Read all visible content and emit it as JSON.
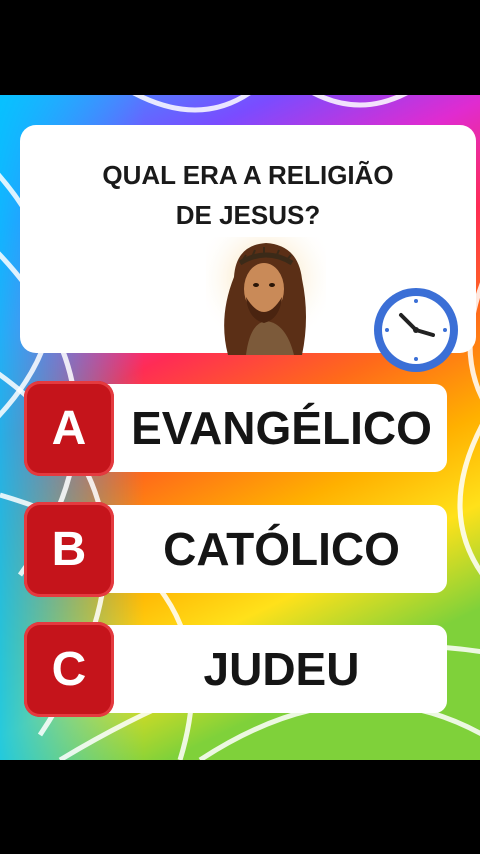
{
  "question": {
    "line1": "QUAL ERA A RELIGIÃO",
    "line2": "DE JESUS?"
  },
  "icons": {
    "portrait": "jesus-portrait-image",
    "timer": "clock-icon"
  },
  "options": [
    {
      "letter": "A",
      "answer": "EVANGÉLICO"
    },
    {
      "letter": "B",
      "answer": "CATÓLICO"
    },
    {
      "letter": "C",
      "answer": "JUDEU"
    }
  ],
  "colors": {
    "letter_box": "#c5141b",
    "clock_ring": "#3b6fd6",
    "background": "#000000"
  }
}
